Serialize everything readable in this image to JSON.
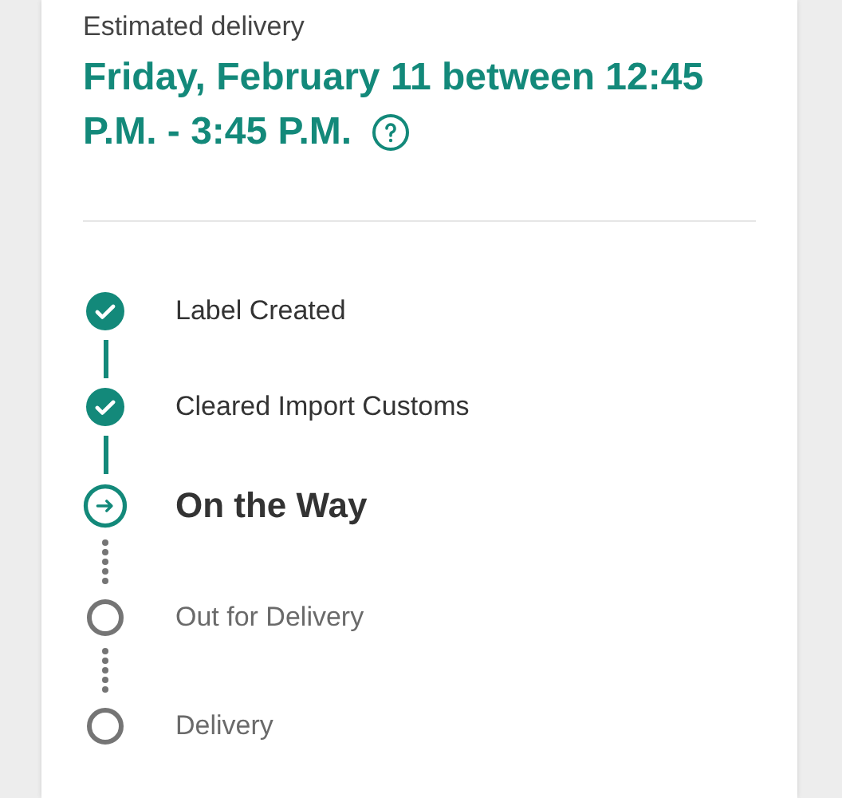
{
  "delivery": {
    "label": "Estimated delivery",
    "date_lines": [
      "Friday, February 11 between 12:45",
      "P.M. - 3:45 P.M."
    ]
  },
  "steps": [
    {
      "label": "Label Created",
      "kind": "done"
    },
    {
      "label": "Cleared Import Customs",
      "kind": "done"
    },
    {
      "label": "On the Way",
      "kind": "current"
    },
    {
      "label": "Out for Delivery",
      "kind": "pending"
    },
    {
      "label": "Delivery",
      "kind": "pending"
    }
  ]
}
